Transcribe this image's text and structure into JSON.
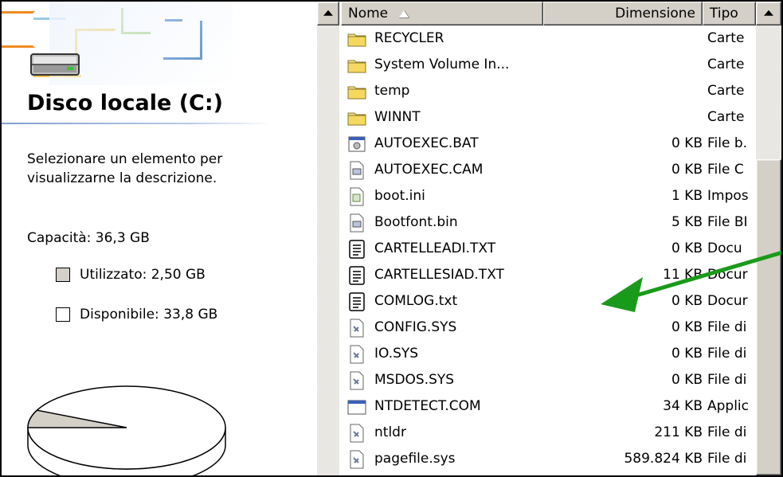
{
  "left_panel": {
    "title": "Disco locale (C:)",
    "description": "Selezionare un elemento per visualizzarne la descrizione.",
    "capacity": "Capacità: 36,3 GB",
    "used": "Utilizzato: 2,50 GB",
    "free": "Disponibile: 33,8 GB",
    "used_fraction": 0.069,
    "used_color": "#d4d0c8",
    "free_color": "#ffffff"
  },
  "columns": {
    "name": "Nome",
    "size": "Dimensione",
    "type": "Tipo"
  },
  "files": [
    {
      "name": "RECYCLER",
      "size": "",
      "type": "Carte",
      "icon": "folder-icon"
    },
    {
      "name": "System Volume In...",
      "size": "",
      "type": "Carte",
      "icon": "folder-icon"
    },
    {
      "name": "temp",
      "size": "",
      "type": "Carte",
      "icon": "folder-icon"
    },
    {
      "name": "WINNT",
      "size": "",
      "type": "Carte",
      "icon": "folder-icon"
    },
    {
      "name": "AUTOEXEC.BAT",
      "size": "0 KB",
      "type": "File b.",
      "icon": "batch-file-icon"
    },
    {
      "name": "AUTOEXEC.CAM",
      "size": "0 KB",
      "type": "File C",
      "icon": "generic-file-icon"
    },
    {
      "name": "boot.ini",
      "size": "1 KB",
      "type": "Impos",
      "icon": "settings-file-icon"
    },
    {
      "name": "Bootfont.bin",
      "size": "5 KB",
      "type": "File BI",
      "icon": "generic-file-icon"
    },
    {
      "name": "CARTELLEADI.TXT",
      "size": "0 KB",
      "type": "Docu",
      "icon": "text-file-icon"
    },
    {
      "name": "CARTELLESIAD.TXT",
      "size": "11 KB",
      "type": "Docur",
      "icon": "text-file-icon"
    },
    {
      "name": "COMLOG.txt",
      "size": "0 KB",
      "type": "Docur",
      "icon": "text-file-icon"
    },
    {
      "name": "CONFIG.SYS",
      "size": "0 KB",
      "type": "File di",
      "icon": "system-file-icon"
    },
    {
      "name": "IO.SYS",
      "size": "0 KB",
      "type": "File di",
      "icon": "system-file-icon"
    },
    {
      "name": "MSDOS.SYS",
      "size": "0 KB",
      "type": "File di",
      "icon": "system-file-icon"
    },
    {
      "name": "NTDETECT.COM",
      "size": "34 KB",
      "type": "Applic",
      "icon": "application-icon"
    },
    {
      "name": "ntldr",
      "size": "211 KB",
      "type": "File di",
      "icon": "system-file-icon"
    },
    {
      "name": "pagefile.sys",
      "size": "589.824 KB",
      "type": "File di",
      "icon": "system-file-icon"
    }
  ],
  "annotation": {
    "arrow_color": "#1a9a1a"
  }
}
